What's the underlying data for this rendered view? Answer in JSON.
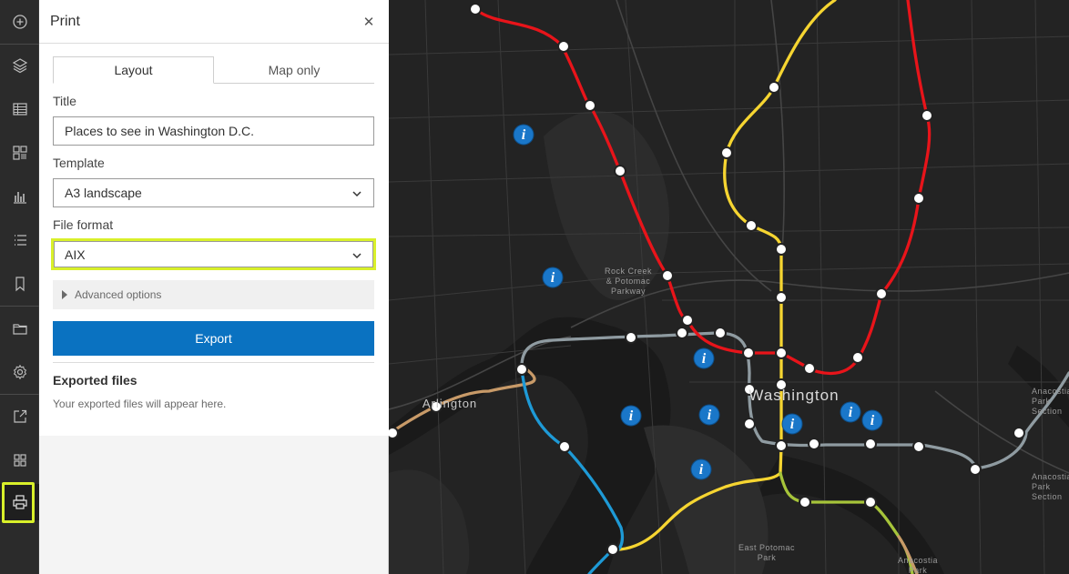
{
  "toolbar": {
    "items": [
      "add-icon",
      "layers-icon",
      "table-icon",
      "widgets-icon",
      "chart-icon",
      "legend-icon",
      "bookmark-icon",
      "folder-icon",
      "settings-icon",
      "share-icon",
      "apps-icon",
      "print-icon"
    ],
    "active": "print-icon",
    "highlight_color": "#d9f02a"
  },
  "panel": {
    "title": "Print",
    "tabs": [
      {
        "label": "Layout",
        "active": true
      },
      {
        "label": "Map only",
        "active": false
      }
    ],
    "title_field": {
      "label": "Title",
      "value": "Places to see in Washington D.C."
    },
    "template_field": {
      "label": "Template",
      "value": "A3 landscape"
    },
    "format_field": {
      "label": "File format",
      "value": "AIX"
    },
    "advanced_label": "Advanced options",
    "export_label": "Export",
    "exported_heading": "Exported files",
    "exported_note": "Your exported files will appear here."
  },
  "map": {
    "labels": {
      "washington": "Washington",
      "arlington": "Arlington",
      "rock_creek": [
        "Rock Creek",
        "& Potomac",
        "Parkway"
      ],
      "east_potomac": [
        "East Potomac",
        "Park"
      ],
      "anacostia_park_1": [
        "Anacostia",
        "Park",
        "Section"
      ],
      "anacostia_park_2": [
        "Anacostia",
        "Park",
        "Section"
      ],
      "anacostia_bottom": [
        "Anacostia",
        "Park"
      ]
    },
    "line_colors": {
      "red": "#e8141a",
      "yellow": "#f6d531",
      "blue": "#1e9ad6",
      "gray": "#8f9ba1",
      "green": "#a6c43a",
      "orange": "#c89a68"
    },
    "info_icon_color": "#1a77c9"
  }
}
